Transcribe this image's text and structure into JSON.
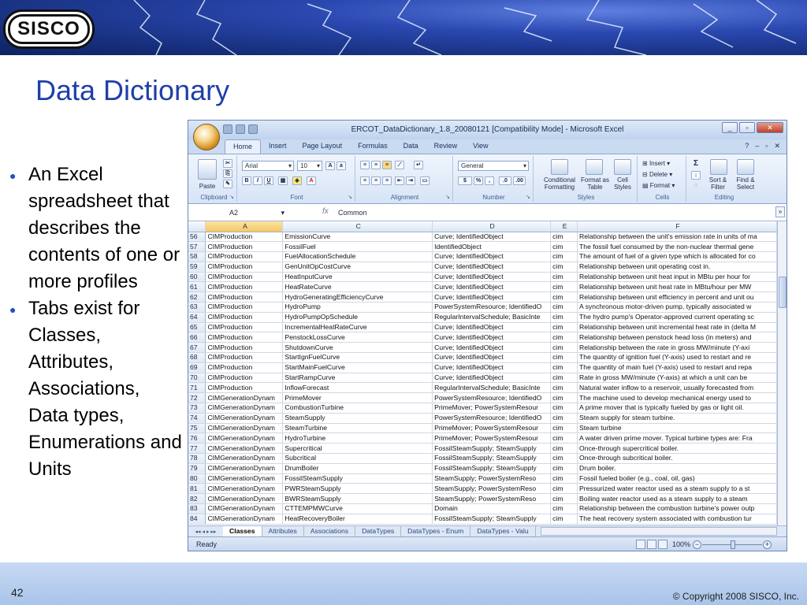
{
  "slide": {
    "title": "Data Dictionary",
    "number": "42",
    "copyright": "© Copyright 2008 SISCO, Inc.",
    "bullets": [
      "An Excel spreadsheet that describes the contents of one or more profiles",
      "Tabs exist for Classes, Attributes, Associations, Data types, Enumerations and Units"
    ]
  },
  "logo": {
    "text": "SISCO"
  },
  "excel": {
    "window_title": "ERCOT_DataDictionary_1.8_20080121  [Compatibility Mode] - Microsoft Excel",
    "ribbon_tabs": [
      "Home",
      "Insert",
      "Page Layout",
      "Formulas",
      "Data",
      "Review",
      "View"
    ],
    "groups": {
      "clipboard": "Clipboard",
      "font": "Font",
      "alignment": "Alignment",
      "number": "Number",
      "styles": "Styles",
      "cells": "Cells",
      "editing": "Editing"
    },
    "font_name": "Arial",
    "font_size": "10",
    "number_format": "General",
    "buttons": {
      "paste": "Paste",
      "conditional_formatting": "Conditional Formatting",
      "format_as_table": "Format as Table",
      "cell_styles": "Cell Styles",
      "insert": "Insert",
      "delete": "Delete",
      "format": "Format",
      "sort_filter": "Sort & Filter",
      "find_select": "Find & Select"
    },
    "name_box": "A2",
    "formula_value": "Common",
    "columns": [
      "A",
      "C",
      "D",
      "E",
      "F"
    ],
    "rows": [
      [
        "56",
        "CIMProduction",
        "EmissionCurve",
        "Curve; IdentifiedObject",
        "cim",
        "Relationship between the unit's emission rate in units of ma"
      ],
      [
        "57",
        "CIMProduction",
        "FossilFuel",
        "IdentifiedObject",
        "cim",
        "The fossil fuel consumed by the non-nuclear thermal gene"
      ],
      [
        "58",
        "CIMProduction",
        "FuelAllocationSchedule",
        "Curve; IdentifiedObject",
        "cim",
        "The amount of fuel of a given type which is allocated for co"
      ],
      [
        "59",
        "CIMProduction",
        "GenUnitOpCostCurve",
        "Curve; IdentifiedObject",
        "cim",
        "Relationship between unit operating cost in."
      ],
      [
        "60",
        "CIMProduction",
        "HeatInputCurve",
        "Curve; IdentifiedObject",
        "cim",
        "Relationship between unit heat input in MBtu per hour for"
      ],
      [
        "61",
        "CIMProduction",
        "HeatRateCurve",
        "Curve; IdentifiedObject",
        "cim",
        "Relationship between unit heat rate in MBtu/hour per MW"
      ],
      [
        "62",
        "CIMProduction",
        "HydroGeneratingEfficiencyCurve",
        "Curve; IdentifiedObject",
        "cim",
        "Relationship between unit efficiency in percent and unit ou"
      ],
      [
        "63",
        "CIMProduction",
        "HydroPump",
        "PowerSystemResource; IdentifiedO",
        "cim",
        "A synchronous motor-driven pump, typically associated w"
      ],
      [
        "64",
        "CIMProduction",
        "HydroPumpOpSchedule",
        "RegularIntervalSchedule; BasicInte",
        "cim",
        "The hydro pump's Operator-approved current operating sc"
      ],
      [
        "65",
        "CIMProduction",
        "IncrementalHeatRateCurve",
        "Curve; IdentifiedObject",
        "cim",
        "Relationship between unit incremental heat rate in (delta M"
      ],
      [
        "66",
        "CIMProduction",
        "PenstockLossCurve",
        "Curve; IdentifiedObject",
        "cim",
        "Relationship between penstock head loss (in meters) and"
      ],
      [
        "67",
        "CIMProduction",
        "ShutdownCurve",
        "Curve; IdentifiedObject",
        "cim",
        "Relationship between the rate in gross MW/minute (Y-axi"
      ],
      [
        "68",
        "CIMProduction",
        "StartIgnFuelCurve",
        "Curve; IdentifiedObject",
        "cim",
        "The quantity of ignition fuel (Y-axis) used to restart and re"
      ],
      [
        "69",
        "CIMProduction",
        "StartMainFuelCurve",
        "Curve; IdentifiedObject",
        "cim",
        "The quantity of main fuel (Y-axis) used to restart and repa"
      ],
      [
        "70",
        "CIMProduction",
        "StartRampCurve",
        "Curve; IdentifiedObject",
        "cim",
        "Rate in gross MW/minute (Y-axis) at which a unit can be"
      ],
      [
        "71",
        "CIMProduction",
        "InflowForecast",
        "RegularIntervalSchedule; BasicInte",
        "cim",
        "Natural water inflow to a reservoir, usually forecasted from"
      ],
      [
        "72",
        "CIMGenerationDynam",
        "PrimeMover",
        "PowerSystemResource; IdentifiedO",
        "cim",
        "The machine used to develop mechanical energy used to"
      ],
      [
        "73",
        "CIMGenerationDynam",
        "CombustionTurbine",
        "PrimeMover; PowerSystemResour",
        "cim",
        "A prime mover that is typically fueled by gas or light oil."
      ],
      [
        "74",
        "CIMGenerationDynam",
        "SteamSupply",
        "PowerSystemResource; IdentifiedO",
        "cim",
        "Steam supply for steam turbine."
      ],
      [
        "75",
        "CIMGenerationDynam",
        "SteamTurbine",
        "PrimeMover; PowerSystemResour",
        "cim",
        "Steam turbine"
      ],
      [
        "76",
        "CIMGenerationDynam",
        "HydroTurbine",
        "PrimeMover; PowerSystemResour",
        "cim",
        "A water driven prime mover. Typical turbine types are: Fra"
      ],
      [
        "77",
        "CIMGenerationDynam",
        "Supercritical",
        "FossilSteamSupply; SteamSupply",
        "cim",
        "Once-through supercritical boiler."
      ],
      [
        "78",
        "CIMGenerationDynam",
        "Subcritical",
        "FossilSteamSupply; SteamSupply",
        "cim",
        "Once-through subcritical boiler."
      ],
      [
        "79",
        "CIMGenerationDynam",
        "DrumBoiler",
        "FossilSteamSupply; SteamSupply",
        "cim",
        "Drum boiler."
      ],
      [
        "80",
        "CIMGenerationDynam",
        "FossilSteamSupply",
        "SteamSupply; PowerSystemReso",
        "cim",
        "Fossil fueled boiler (e.g., coal, oil, gas)"
      ],
      [
        "81",
        "CIMGenerationDynam",
        "PWRSteamSupply",
        "SteamSupply; PowerSystemReso",
        "cim",
        "Pressurized water reactor used as a steam supply to a st"
      ],
      [
        "82",
        "CIMGenerationDynam",
        "BWRSteamSupply",
        "SteamSupply; PowerSystemReso",
        "cim",
        "Boiling water reactor used as a steam supply to a steam"
      ],
      [
        "83",
        "CIMGenerationDynam",
        "CTTEMPMWCurve",
        "Domain",
        "cim",
        "Relationship between the combustion turbine's power outp"
      ],
      [
        "84",
        "CIMGenerationDynam",
        "HeatRecoveryBoiler",
        "FossilSteamSupply; SteamSupply",
        "cim",
        "The heat recovery system associated with combustion tur"
      ]
    ],
    "sheet_tabs": [
      "Classes",
      "Attributes",
      "Associations",
      "DataTypes",
      "DataTypes - Enum",
      "DataTypes - Valu"
    ],
    "active_sheet": "Classes",
    "status": "Ready",
    "zoom": "100%"
  }
}
